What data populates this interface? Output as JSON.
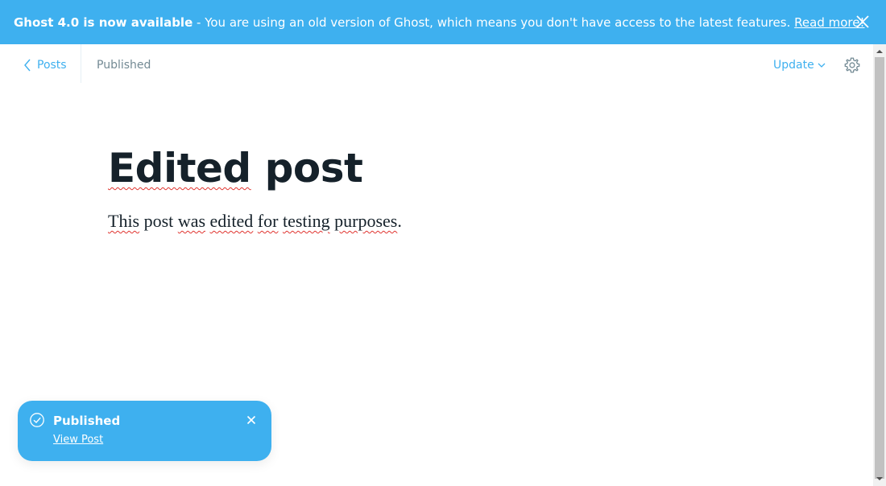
{
  "banner": {
    "title": "Ghost 4.0 is now available",
    "separator": " - ",
    "message": "You are using an old version of Ghost, which means you don't have access to the latest features. ",
    "link_label": "Read more!",
    "close_icon": "close-icon",
    "background": "#3eb0ef"
  },
  "header": {
    "back_label": "Posts",
    "status": "Published",
    "update_label": "Update",
    "settings_icon": "gear-icon"
  },
  "post": {
    "title_words": [
      "Edited",
      "post"
    ],
    "body_parts": [
      "This",
      " post ",
      "was",
      " ",
      "edited",
      " ",
      "for",
      " ",
      "testing",
      " ",
      "purposes",
      "."
    ]
  },
  "toast": {
    "title": "Published",
    "link_label": "View Post",
    "icon": "check-circle-icon"
  }
}
